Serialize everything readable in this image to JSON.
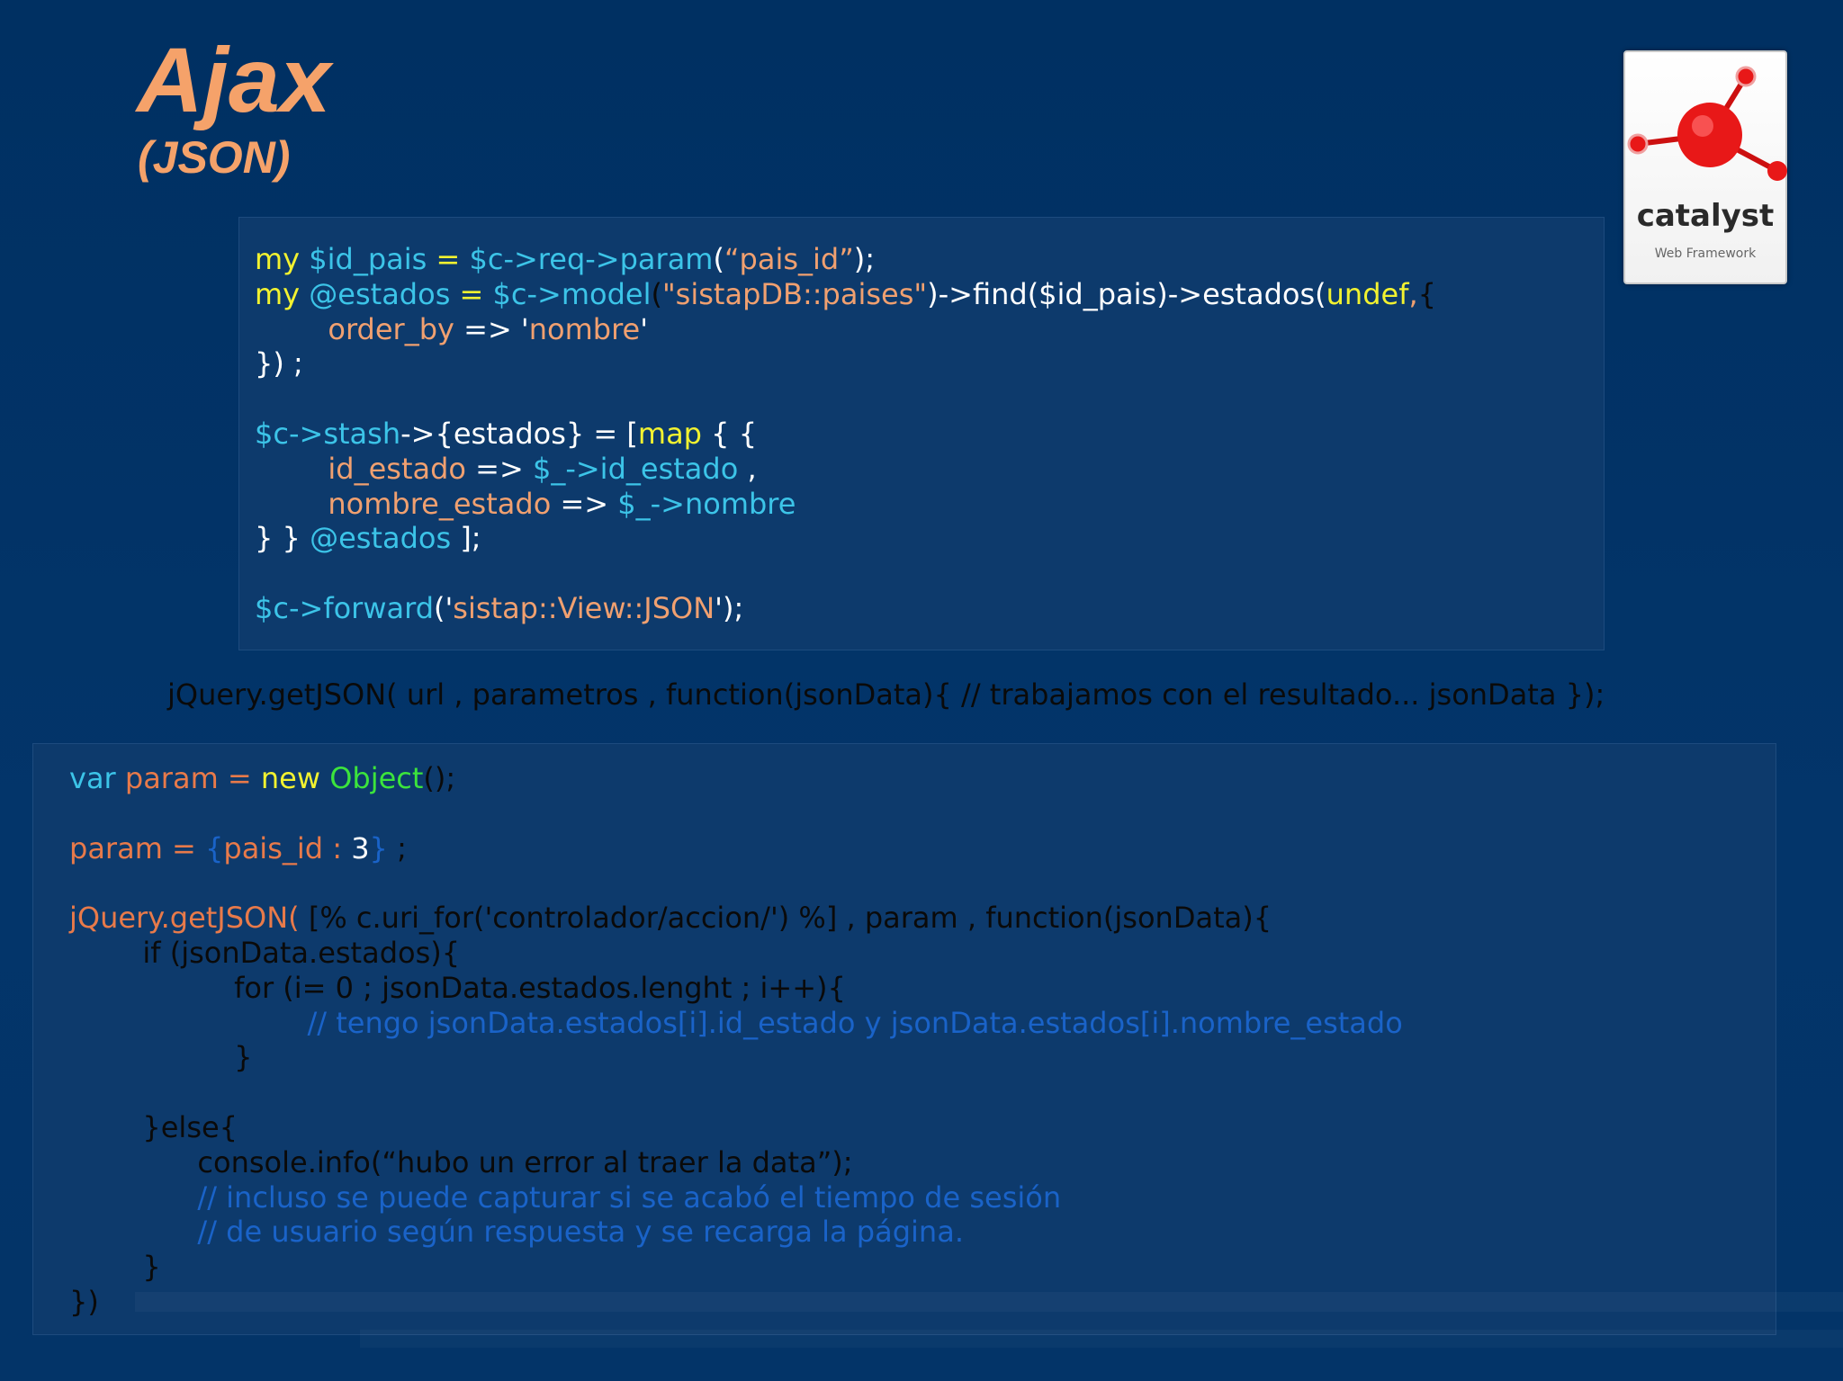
{
  "slide": {
    "title": "Ajax",
    "subtitle": "(JSON)",
    "logo": {
      "name": "catalyst",
      "tagline": "Web Framework"
    },
    "mid_line": "jQuery.getJSON( url , parametros , function(jsonData){ // trabajamos con el resultado... jsonData });"
  },
  "colors": {
    "title": "#f5a26a",
    "keyword_yellow": "#f2f230",
    "var_cyan": "#3cc4e8",
    "string_orange": "#f0a070",
    "plain_white": "#ffffff",
    "js_orange": "#e87a4a",
    "js_green": "#3ce43c",
    "js_black": "#0a0a0a",
    "comment_blue": "#1a63c8"
  },
  "perl_code": [
    [
      {
        "t": "my ",
        "c": "#f2f230"
      },
      {
        "t": "$id_pais",
        "c": "#3cc4e8"
      },
      {
        "t": " = ",
        "c": "#f2f230"
      },
      {
        "t": "$c->req->param",
        "c": "#3cc4e8"
      },
      {
        "t": "(",
        "c": "#ffffff"
      },
      {
        "t": "“pais_id”",
        "c": "#f0a070"
      },
      {
        "t": ");",
        "c": "#ffffff"
      }
    ],
    [
      {
        "t": "my ",
        "c": "#f2f230"
      },
      {
        "t": "@estados",
        "c": "#3cc4e8"
      },
      {
        "t": " = ",
        "c": "#f2f230"
      },
      {
        "t": "$c->model",
        "c": "#3cc4e8"
      },
      {
        "t": "(",
        "c": "#0a0a0a"
      },
      {
        "t": "\"sistapDB::paises\"",
        "c": "#f0a070"
      },
      {
        "t": ")->find($id_pais)->estados(",
        "c": "#ffffff"
      },
      {
        "t": "undef",
        "c": "#f2f230"
      },
      {
        "t": ",",
        "c": "#f0a070"
      },
      {
        "t": "{",
        "c": "#0a0a0a"
      }
    ],
    [
      {
        "t": "        ",
        "c": "#ffffff"
      },
      {
        "t": "order_by",
        "c": "#f0a070"
      },
      {
        "t": " => '",
        "c": "#ffffff"
      },
      {
        "t": "nombre",
        "c": "#f0a070"
      },
      {
        "t": "'",
        "c": "#ffffff"
      }
    ],
    [
      {
        "t": "}) ;",
        "c": "#ffffff"
      }
    ],
    [],
    [
      {
        "t": "$c->stash",
        "c": "#3cc4e8"
      },
      {
        "t": "->{estados} = [",
        "c": "#ffffff"
      },
      {
        "t": "map",
        "c": "#f2f230"
      },
      {
        "t": " { {",
        "c": "#ffffff"
      }
    ],
    [
      {
        "t": "        ",
        "c": "#ffffff"
      },
      {
        "t": "id_estado",
        "c": "#f0a070"
      },
      {
        "t": " => ",
        "c": "#ffffff"
      },
      {
        "t": "$_->id_estado",
        "c": "#3cc4e8"
      },
      {
        "t": " ,",
        "c": "#ffffff"
      }
    ],
    [
      {
        "t": "        ",
        "c": "#ffffff"
      },
      {
        "t": "nombre_estado",
        "c": "#f0a070"
      },
      {
        "t": " => ",
        "c": "#ffffff"
      },
      {
        "t": "$_->nombre",
        "c": "#3cc4e8"
      }
    ],
    [
      {
        "t": "} } ",
        "c": "#ffffff"
      },
      {
        "t": "@estados",
        "c": "#3cc4e8"
      },
      {
        "t": " ];",
        "c": "#ffffff"
      }
    ],
    [],
    [
      {
        "t": "$c->forward",
        "c": "#3cc4e8"
      },
      {
        "t": "('",
        "c": "#ffffff"
      },
      {
        "t": "sistap::View::JSON",
        "c": "#f0a070"
      },
      {
        "t": "');",
        "c": "#ffffff"
      }
    ]
  ],
  "js_code": [
    [
      {
        "t": "var ",
        "c": "#3cc4e8"
      },
      {
        "t": "param = ",
        "c": "#e87a4a"
      },
      {
        "t": "new ",
        "c": "#f2f230"
      },
      {
        "t": "Object",
        "c": "#3ce43c"
      },
      {
        "t": "();",
        "c": "#0a0a0a"
      }
    ],
    [],
    [
      {
        "t": "param = ",
        "c": "#e87a4a"
      },
      {
        "t": "{",
        "c": "#1a63c8"
      },
      {
        "t": "pais_id : ",
        "c": "#e87a4a"
      },
      {
        "t": "3",
        "c": "#ffffff"
      },
      {
        "t": "}",
        "c": "#1a63c8"
      },
      {
        "t": " ;",
        "c": "#0a0a0a"
      }
    ],
    [],
    [
      {
        "t": "jQuery.getJSON( ",
        "c": "#e87a4a"
      },
      {
        "t": "[% c.uri_for('controlador/accion/') %] , param , function(jsonData){",
        "c": "#0a0a0a"
      }
    ],
    [
      {
        "t": "        if (jsonData.estados){",
        "c": "#0a0a0a"
      }
    ],
    [
      {
        "t": "                  for (i= 0 ; jsonData.estados.lenght ; i++){",
        "c": "#0a0a0a"
      }
    ],
    [
      {
        "t": "                          ",
        "c": "#0a0a0a"
      },
      {
        "t": "// tengo jsonData.estados[i].id_estado y jsonData.estados[i].nombre_estado",
        "c": "#1a63c8"
      }
    ],
    [
      {
        "t": "                  }",
        "c": "#0a0a0a"
      }
    ],
    [],
    [
      {
        "t": "        }else{",
        "c": "#0a0a0a"
      }
    ],
    [
      {
        "t": "              console.info(“hubo un error al traer la data”);",
        "c": "#0a0a0a"
      }
    ],
    [
      {
        "t": "              ",
        "c": "#0a0a0a"
      },
      {
        "t": "// incluso se puede capturar si se acabó el tiempo de sesión",
        "c": "#1a63c8"
      }
    ],
    [
      {
        "t": "              ",
        "c": "#0a0a0a"
      },
      {
        "t": "// de usuario según respuesta y se recarga la página.",
        "c": "#1a63c8"
      }
    ],
    [
      {
        "t": "        }",
        "c": "#0a0a0a"
      }
    ],
    [
      {
        "t": "})",
        "c": "#0a0a0a"
      }
    ]
  ]
}
